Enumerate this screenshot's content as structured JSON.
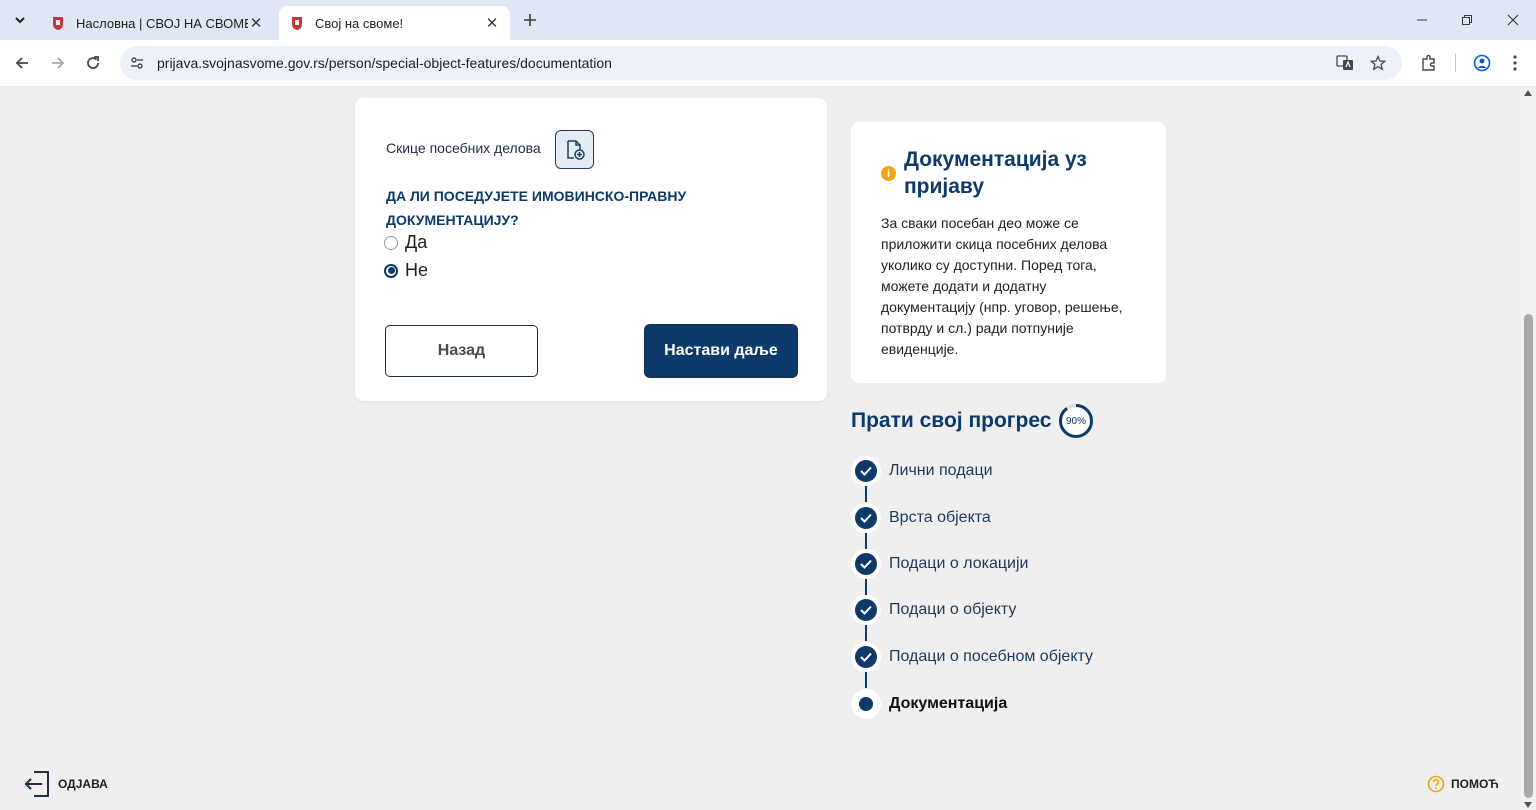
{
  "browser": {
    "tabs": [
      {
        "title": "Насловна | СВОЈ НА СВОМЕ",
        "active": false
      },
      {
        "title": "Свој на своме!",
        "active": true
      }
    ],
    "url": "prijava.svojnasvome.gov.rs/person/special-object-features/documentation"
  },
  "form": {
    "sketch_label": "Скице посебних делова",
    "question": "ДА ЛИ ПОСЕДУЈЕТЕ ИМОВИНСКО-ПРАВНУ ДОКУМЕНТАЦИЈУ?",
    "options": [
      {
        "label": "Да",
        "selected": false
      },
      {
        "label": "Не",
        "selected": true
      }
    ],
    "back_label": "Назад",
    "next_label": "Настави даље"
  },
  "info": {
    "title": "Документација уз пријаву",
    "text": "За сваки посебан део може се приложити скица посебних делова уколико су доступни. Поред тога, можете додати и додатну документацију (нпр. уговор, решење, потврду и сл.) ради потпуније евиденције."
  },
  "progress": {
    "title": "Прати свој прогрес",
    "percent_label": "90%",
    "percent": 90,
    "steps": [
      {
        "label": "Лични подаци",
        "status": "done"
      },
      {
        "label": "Врста објекта",
        "status": "done"
      },
      {
        "label": "Подаци о локацији",
        "status": "done"
      },
      {
        "label": "Подаци о објекту",
        "status": "done"
      },
      {
        "label": "Подаци о посебном објекту",
        "status": "done"
      },
      {
        "label": "Документација",
        "status": "current"
      }
    ]
  },
  "footer": {
    "logout_label": "ОДЈАВА",
    "help_label": "ПОМОЋ"
  },
  "colors": {
    "primary": "#0b3a6b",
    "accent": "#f2a413",
    "background": "#efefef"
  }
}
